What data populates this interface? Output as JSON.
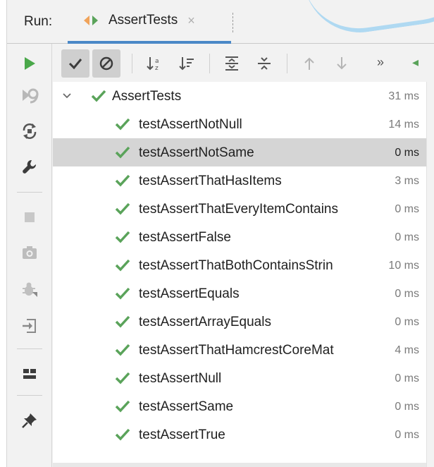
{
  "header": {
    "run_label": "Run:",
    "tab_label": "AssertTests",
    "tab_close": "×"
  },
  "toolbar": {
    "more": "»"
  },
  "tree": {
    "root": {
      "label": "AssertTests",
      "time": "31 ms"
    },
    "items": [
      {
        "label": "testAssertNotNull",
        "time": "14 ms"
      },
      {
        "label": "testAssertNotSame",
        "time": "0 ms"
      },
      {
        "label": "testAssertThatHasItems",
        "time": "3 ms"
      },
      {
        "label": "testAssertThatEveryItemContains",
        "time": "0 ms"
      },
      {
        "label": "testAssertFalse",
        "time": "0 ms"
      },
      {
        "label": "testAssertThatBothContainsStrin",
        "time": "10 ms"
      },
      {
        "label": "testAssertEquals",
        "time": "0 ms"
      },
      {
        "label": "testAssertArrayEquals",
        "time": "0 ms"
      },
      {
        "label": "testAssertThatHamcrestCoreMat",
        "time": "4 ms"
      },
      {
        "label": "testAssertNull",
        "time": "0 ms"
      },
      {
        "label": "testAssertSame",
        "time": "0 ms"
      },
      {
        "label": "testAssertTrue",
        "time": "0 ms"
      }
    ]
  },
  "colors": {
    "pass_green": "#5aa35a",
    "run_green": "#4aa84a",
    "tab_accent": "#4a88c7",
    "selection": "#d5d5d5"
  }
}
